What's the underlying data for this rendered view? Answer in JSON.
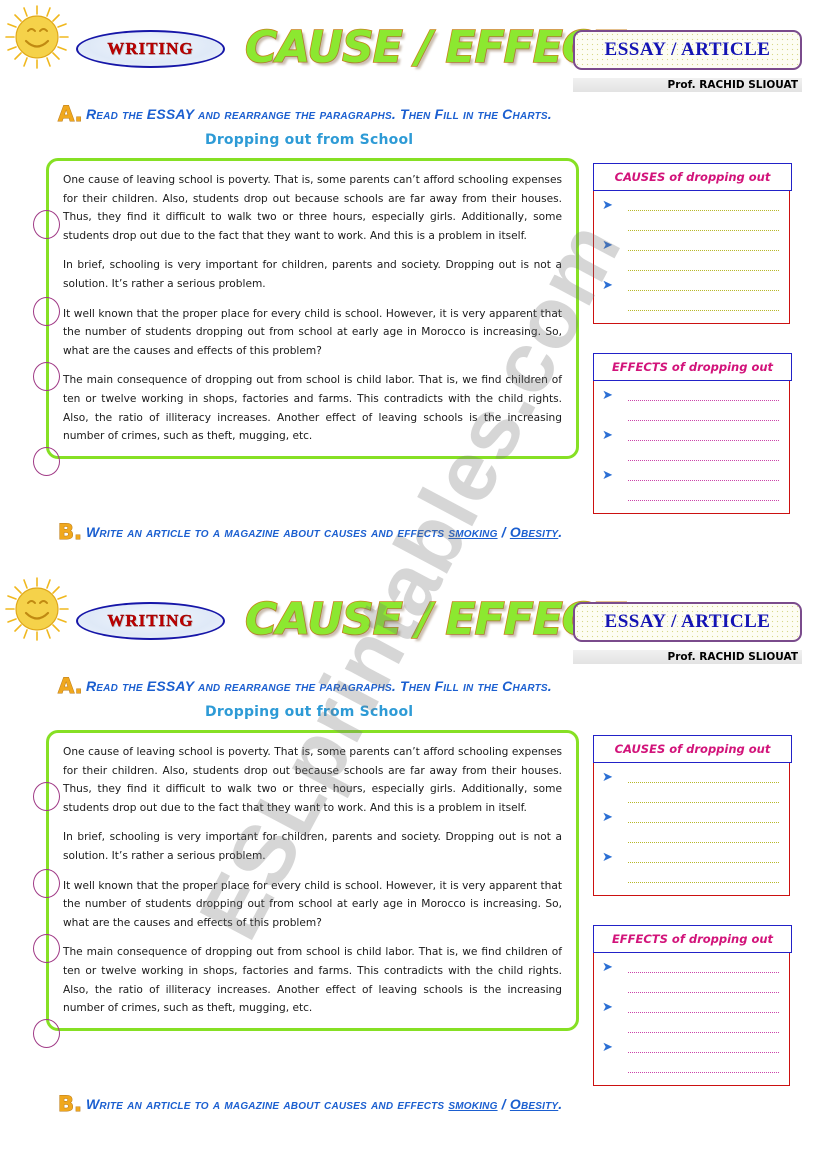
{
  "header": {
    "writing_badge": "WRITING",
    "main_title": "CAUSE / EFFECT",
    "essay_article": "ESSAY / ARTICLE",
    "professor": "Prof. RACHID SLIOUAT",
    "sun_icon": "sun-smiley-icon"
  },
  "task_a": {
    "letter": "A.",
    "instruction": "Read the ESSAY and rearrange the paragraphs. Then Fill in the Charts.",
    "essay_title": "Dropping out from School"
  },
  "task_b": {
    "letter": "B.",
    "instruction_pre": "Write an article to a magazine about causes and effects ",
    "link_1": "smoking",
    "separator": " / ",
    "link_2": "Obesity",
    "instruction_post": "."
  },
  "essay": {
    "paragraphs": [
      "One cause of leaving school is poverty. That is, some parents can’t afford schooling expenses for their children. Also, students drop out because schools are far away from their houses.  Thus, they find it difficult to walk two or three hours, especially girls. Additionally, some students drop out due to the fact that they want to work. And this is a problem in itself.",
      "In brief, schooling is very important for children, parents and society. Dropping out is not a solution. It’s rather a serious problem.",
      "It well known that the proper place for every child is school. However, it is very apparent that the number of students dropping out from school at early age in Morocco is increasing. So, what are the causes and effects of this problem?",
      "The main consequence of dropping out from school is child labor.  That is, we find children of ten or twelve working in shops, factories and farms. This contradicts with the child rights. Also, the ratio of illiteracy increases. Another effect of leaving schools is the increasing number of crimes, such as theft, mugging, etc."
    ]
  },
  "charts": {
    "causes": {
      "title": "CAUSES of dropping out",
      "bullet": "➤",
      "rows": 6,
      "bullet_rows": [
        0,
        2,
        4
      ],
      "line_color": "#b8b82a"
    },
    "effects": {
      "title": "EFFECTS of dropping out",
      "bullet": "➤",
      "rows": 6,
      "bullet_rows": [
        0,
        2,
        4
      ],
      "line_color": "#cc44aa"
    }
  },
  "watermark": {
    "text": "ESLprintables.com"
  },
  "colors": {
    "title_green": "#8ce830",
    "title_outline": "#c8821c",
    "border_green": "#86e024",
    "border_red": "#cc1111",
    "border_blue": "#2222c8",
    "chart_title_pink": "#d2137a",
    "instruction_blue": "#1b5fd0",
    "essay_title_blue": "#2e9bd6",
    "letter_orange": "#f0a81e",
    "writing_red": "#c00000",
    "essay_article_blue": "#1414b4",
    "circle_purple": "#a03a86"
  }
}
